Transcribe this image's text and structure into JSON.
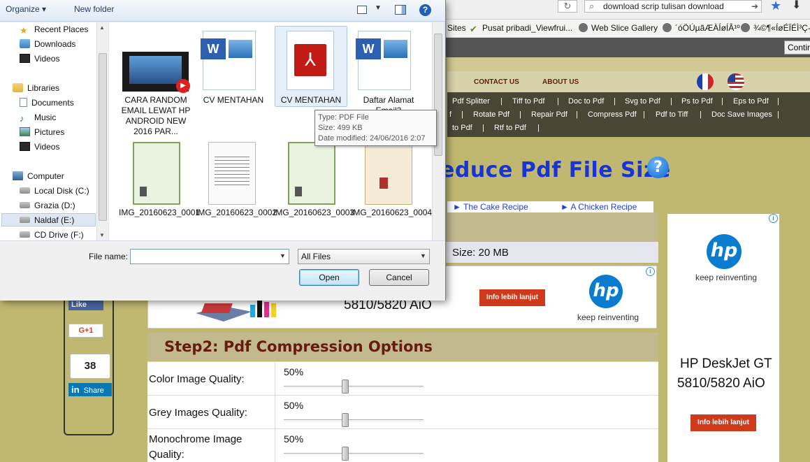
{
  "browser": {
    "search_text": "download scrip tulisan download",
    "bookmarks": [
      {
        "label": "Sites"
      },
      {
        "label": "Pusat pribadi_Viewfrui..."
      },
      {
        "label": "Web Slice Gallery"
      },
      {
        "label": "´óÖÚµãÆÀÍøÍÂ¹º"
      },
      {
        "label": "¾©¶«ÍøÉÏÉÌ³Ç-"
      }
    ],
    "continue_label": "Contir"
  },
  "dialog": {
    "toolbar": {
      "organize": "Organize ▾",
      "new_folder": "New folder"
    },
    "nav": [
      {
        "label": "Recent Places",
        "icon": "recent-places-icon"
      },
      {
        "label": "Downloads",
        "icon": "downloads-folder-icon"
      },
      {
        "label": "Videos",
        "icon": "videos-icon"
      },
      {
        "label": "Libraries",
        "icon": "libraries-icon"
      },
      {
        "label": "Documents",
        "icon": "documents-icon"
      },
      {
        "label": "Music",
        "icon": "music-icon"
      },
      {
        "label": "Pictures",
        "icon": "pictures-icon"
      },
      {
        "label": "Videos",
        "icon": "videos-icon"
      },
      {
        "label": "Computer",
        "icon": "computer-icon"
      },
      {
        "label": "Local Disk (C:)",
        "icon": "disk-icon"
      },
      {
        "label": "Grazia (D:)",
        "icon": "disk-icon"
      },
      {
        "label": "Naldaf (E:)",
        "icon": "disk-icon"
      },
      {
        "label": "CD Drive (F:)",
        "icon": "cd-drive-icon"
      }
    ],
    "files": [
      {
        "name": "CARA RANDOM EMAIL LEWAT HP ANDROID NEW 2016 PAR...",
        "kind": "video"
      },
      {
        "name": "CV MENTAHAN",
        "kind": "word"
      },
      {
        "name": "CV MENTAHAN",
        "kind": "pdf"
      },
      {
        "name": "Daftar Alamat Email2",
        "kind": "word"
      },
      {
        "name": "IMG_20160623_0001",
        "kind": "image"
      },
      {
        "name": "IMG_20160623_0002",
        "kind": "image"
      },
      {
        "name": "IMG_20160623_0003",
        "kind": "image"
      },
      {
        "name": "IMG_20160623_0004",
        "kind": "image"
      }
    ],
    "tooltip": {
      "type": "Type: PDF File",
      "size": "Size: 499 KB",
      "modified": "Date modified: 24/06/2016 2:07"
    },
    "file_name_label": "File name:",
    "file_name_value": "",
    "filter": "All Files",
    "open": "Open",
    "cancel": "Cancel"
  },
  "site": {
    "nav": [
      "CONTACT US",
      "ABOUT US"
    ],
    "tools_row1": [
      "Pdf Splitter",
      "Tiff to Pdf",
      "Doc to Pdf",
      "Svg to Pdf",
      "Ps to Pdf",
      "Eps to Pdf"
    ],
    "tools_row2": [
      "f",
      "Rotate Pdf",
      "Repair Pdf",
      "Compress Pdf",
      "Pdf to Tiff",
      "Doc Save Images"
    ],
    "tools_row3": [
      "to Pdf",
      "Rtf to Pdf"
    ],
    "title": "educe Pdf File Size",
    "help": "?",
    "recipes": [
      "► The Cake Recipe",
      "► A Chicken Recipe"
    ],
    "size_text": "Size: 20 MB",
    "step2_title": "Step2: Pdf Compression Options",
    "options": [
      {
        "label": "Color Image Quality:",
        "value": "50%"
      },
      {
        "label": "Grey Images Quality:",
        "value": "50%"
      },
      {
        "label": "Monochrome Image Quality:",
        "value": "50%"
      }
    ]
  },
  "ads": {
    "mid_model": "5810/5820 AiO",
    "mid_button": "Info lebih lanjut",
    "hp_logo": "hp",
    "tagline": "keep reinventing",
    "side_model_1": "HP DeskJet GT",
    "side_model_2": "5810/5820 AiO",
    "side_button": "Info lebih lanjut",
    "info_glyph": "i"
  },
  "social": {
    "fb_like": "Like",
    "gplus": "G+1",
    "count": "38",
    "li_share": "Share",
    "li_logo": "in"
  },
  "colors": {
    "page_olive": "#c0b870",
    "title_blue": "#1735d6",
    "step_maroon": "#661a10",
    "hp_blue": "#0a7cd0",
    "ad_button": "#cf3a1a"
  }
}
